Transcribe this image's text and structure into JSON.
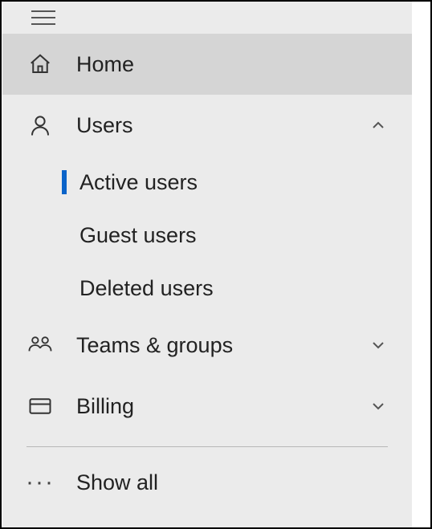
{
  "sidebar": {
    "items": [
      {
        "label": "Home"
      },
      {
        "label": "Users",
        "children": [
          {
            "label": "Active users"
          },
          {
            "label": "Guest users"
          },
          {
            "label": "Deleted users"
          }
        ]
      },
      {
        "label": "Teams & groups"
      },
      {
        "label": "Billing"
      }
    ],
    "show_all_label": "Show all"
  }
}
